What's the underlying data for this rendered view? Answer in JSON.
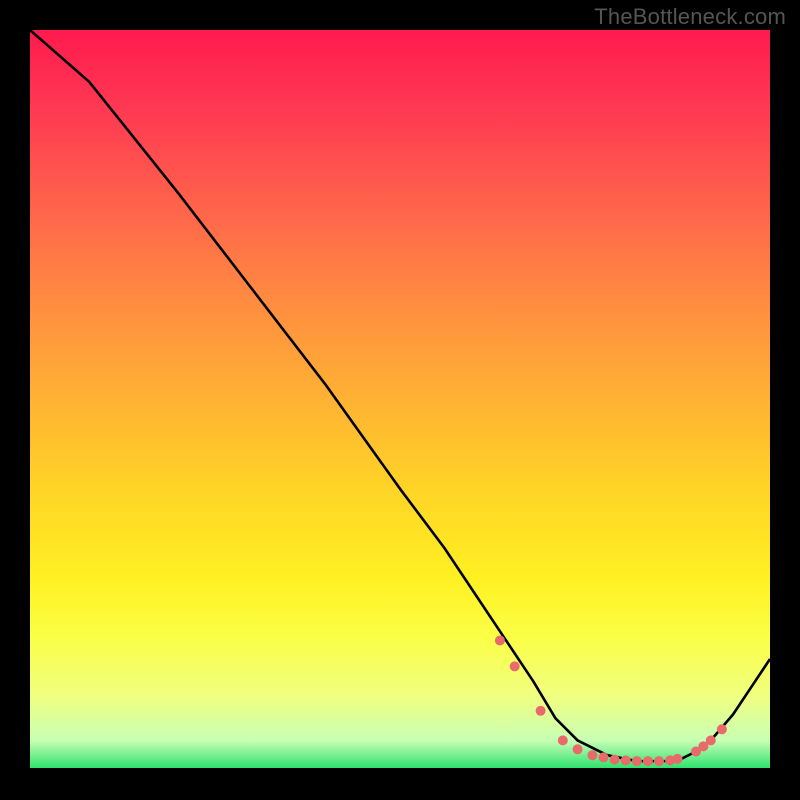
{
  "watermark": "TheBottleneck.com",
  "chart_data": {
    "type": "line",
    "title": "",
    "xlabel": "",
    "ylabel": "",
    "xlim": [
      0,
      100
    ],
    "ylim": [
      0,
      100
    ],
    "grid": false,
    "legend": false,
    "series": [
      {
        "name": "curve",
        "x": [
          0,
          8,
          12,
          20,
          30,
          40,
          50,
          56,
          60,
          64,
          68,
          71,
          74,
          78,
          82,
          86,
          88,
          90,
          92,
          95,
          98,
          100
        ],
        "values": [
          100,
          93,
          88,
          78,
          65,
          52,
          38,
          30,
          24,
          18,
          12,
          7,
          4,
          2,
          1.2,
          1.2,
          1.5,
          2.5,
          4,
          7.5,
          12,
          15
        ],
        "stroke": "#000000",
        "stroke_width": 2.6
      }
    ],
    "markers": {
      "name": "valley-dots",
      "fill": "#e86a6a",
      "radius": 5,
      "x": [
        63.5,
        65.5,
        69,
        72,
        74,
        76,
        77.5,
        79,
        80.5,
        82,
        83.5,
        85,
        86.5,
        87.5,
        90,
        91,
        92,
        93.5
      ],
      "values": [
        17.5,
        14,
        8,
        4,
        2.8,
        2,
        1.7,
        1.4,
        1.3,
        1.2,
        1.2,
        1.2,
        1.3,
        1.5,
        2.5,
        3.2,
        4,
        5.5
      ]
    },
    "background_gradient": {
      "top": "#ff1a4e",
      "mid": "#ffd426",
      "bottom": "#24e06a"
    }
  }
}
